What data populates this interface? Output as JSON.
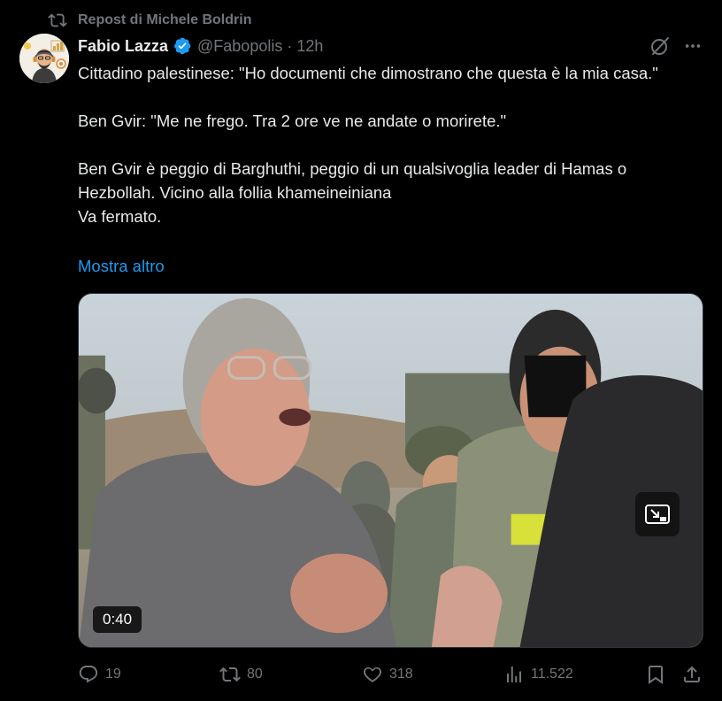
{
  "repost": {
    "label": "Repost di Michele Boldrin"
  },
  "author": {
    "name": "Fabio Lazza",
    "handle": "@Fabopolis",
    "separator": "·",
    "time": "12h"
  },
  "tweet": {
    "lines": [
      "Cittadino palestinese:  \"Ho documenti che dimostrano che questa è la mia casa.\"",
      "",
      "Ben Gvir: \"Me ne frego. Tra 2 ore ve ne andate o morirete.\"",
      "",
      "Ben Gvir è peggio di Barghuthi, peggio di un qualsivoglia leader di Hamas o Hezbollah. Vicino alla follia khameineiniana",
      "Va fermato."
    ],
    "show_more": "Mostra altro"
  },
  "media": {
    "duration": "0:40"
  },
  "actions": {
    "replies": "19",
    "reposts": "80",
    "likes": "318",
    "views": "11.522"
  },
  "colors": {
    "background": "#000000",
    "text": "#e7e9ea",
    "muted": "#71767b",
    "accent": "#1d9bf0",
    "verified": "#1d9bf0"
  },
  "icons": {
    "repost": "repost-icon",
    "verified": "verified-badge-icon",
    "grok": "grok-icon",
    "more": "more-icon",
    "pip": "picture-in-picture-icon",
    "reply": "reply-icon",
    "retweet": "retweet-icon",
    "like": "heart-icon",
    "views": "views-icon",
    "bookmark": "bookmark-icon",
    "share": "share-icon"
  }
}
